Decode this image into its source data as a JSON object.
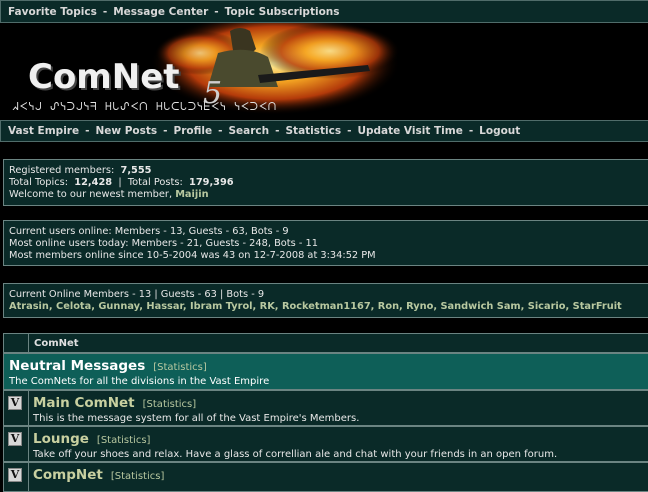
{
  "top_nav": {
    "items": [
      "Favorite Topics",
      "Message Center",
      "Topic Subscriptions"
    ],
    "separator": "-"
  },
  "banner": {
    "logo_text": "ComNet",
    "logo_number": "5",
    "aurebesh_tagline": "ᖽᐸᓭᒍ ᔑᓭᑐᒍᓭᖷ ᕼᒐᔑᐸᑎ ᕼᒐᑕᒐᑐᓭᖶᐸᓭ ᓭᐸᑐᐸᑎ"
  },
  "main_nav": {
    "items": [
      "Vast Empire",
      "New Posts",
      "Profile",
      "Search",
      "Statistics",
      "Update Visit Time",
      "Logout"
    ],
    "separator": "-"
  },
  "stats": {
    "registered_label": "Registered members:",
    "registered_value": "7,555",
    "topics_label": "Total Topics:",
    "topics_value": "12,428",
    "posts_label": "Total Posts:",
    "posts_value": "179,396",
    "newest_label": "Welcome to our newest member,",
    "newest_value": "Maijin"
  },
  "online": {
    "current": "Current users online:  Members - 13, Guests - 63, Bots - 9",
    "today": "Most online users today:  Members - 21, Guests - 248, Bots - 11",
    "record": "Most members online since 10-5-2004 was 43 on 12-7-2008 at 3:34:52 PM"
  },
  "online_members": {
    "summary": "Current Online Members - 13  |  Guests - 63  |  Bots - 9",
    "names": "Atrasin, Celota, Gunnay, Hassar, Ibram Tyrol, RK, Rocketman1167, Ron, Ryno, Sandwich Sam, Sicario, StarFruit"
  },
  "forum": {
    "header": "ComNet",
    "category": {
      "title": "Neutral Messages",
      "stats_link": "[Statistics]",
      "description": "The ComNets for all the divisions in the Vast Empire"
    },
    "boards": [
      {
        "icon": "V",
        "title": "Main ComNet",
        "stats_link": "[Statistics]",
        "description": "This is the message system for all of the Vast Empire's Members."
      },
      {
        "icon": "V",
        "title": "Lounge",
        "stats_link": "[Statistics]",
        "description": "Take off your shoes and relax. Have a glass of correllian ale and chat with your friends in an open forum."
      },
      {
        "icon": "V",
        "title": "CompNet",
        "stats_link": "[Statistics]",
        "description": ""
      }
    ]
  }
}
